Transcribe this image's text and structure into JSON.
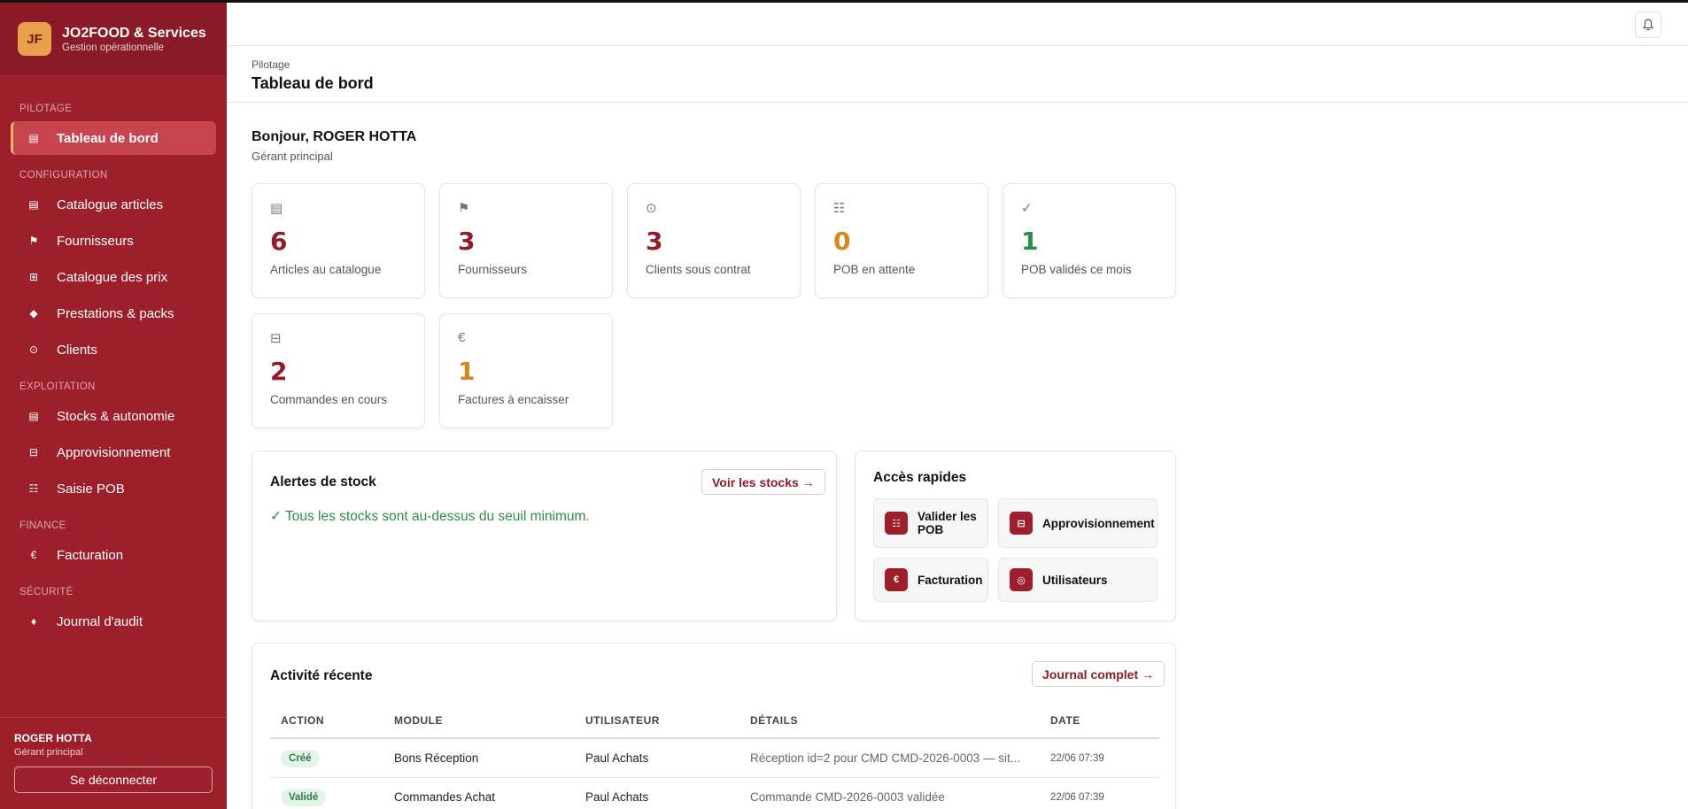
{
  "brand": {
    "logo": "JF",
    "name": "JO2FOOD & Services",
    "subtitle": "Gestion opérationnelle"
  },
  "sidebar": {
    "sections": {
      "pilotage": "PILOTAGE",
      "configuration": "CONFIGURATION",
      "exploitation": "EXPLOITATION",
      "finance": "FINANCE",
      "securite": "SÉCURITÉ"
    },
    "items": [
      {
        "label": "Tableau de bord",
        "icon": "▤"
      },
      {
        "label": "Catalogue articles",
        "icon": "▤"
      },
      {
        "label": "Fournisseurs",
        "icon": "⚑"
      },
      {
        "label": "Catalogue des prix",
        "icon": "⊞"
      },
      {
        "label": "Prestations & packs",
        "icon": "◆"
      },
      {
        "label": "Clients",
        "icon": "⊙"
      },
      {
        "label": "Stocks & autonomie",
        "icon": "▤"
      },
      {
        "label": "Approvisionnement",
        "icon": "⊟"
      },
      {
        "label": "Saisie POB",
        "icon": "☷"
      },
      {
        "label": "Facturation",
        "icon": "€"
      },
      {
        "label": "Journal d'audit",
        "icon": "♦"
      }
    ],
    "user": {
      "name": "ROGER HOTTA",
      "role": "Gérant principal",
      "logout": "Se déconnecter"
    }
  },
  "header": {
    "breadcrumb": "Pilotage",
    "title": "Tableau de bord"
  },
  "greeting": {
    "title": "Bonjour, ROGER HOTTA",
    "role": "Gérant principal"
  },
  "stats": [
    {
      "value": "6",
      "label": "Articles au catalogue",
      "icon": "▤",
      "color": "#8f1c2a"
    },
    {
      "value": "3",
      "label": "Fournisseurs",
      "icon": "⚑",
      "color": "#8f1c2a"
    },
    {
      "value": "3",
      "label": "Clients sous contrat",
      "icon": "⊙",
      "color": "#8f1c2a"
    },
    {
      "value": "0",
      "label": "POB en attente",
      "icon": "☷",
      "color": "#d7871f"
    },
    {
      "value": "1",
      "label": "POB validés ce mois",
      "icon": "✓",
      "color": "#2f8a4e"
    },
    {
      "value": "2",
      "label": "Commandes en cours",
      "icon": "⊟",
      "color": "#8f1c2a"
    },
    {
      "value": "1",
      "label": "Factures à encaisser",
      "icon": "€",
      "color": "#d7871f"
    }
  ],
  "stock_alerts": {
    "title": "Alertes de stock",
    "button": "Voir les stocks →",
    "message": "✓ Tous les stocks sont au-dessus du seuil minimum."
  },
  "quick_access": {
    "title": "Accès rapides",
    "items": [
      {
        "label": "Valider les POB",
        "icon": "☷"
      },
      {
        "label": "Approvisionnement",
        "icon": "⊟"
      },
      {
        "label": "Facturation",
        "icon": "€"
      },
      {
        "label": "Utilisateurs",
        "icon": "◎"
      }
    ]
  },
  "activity": {
    "title": "Activité récente",
    "button": "Journal complet →",
    "columns": [
      "ACTION",
      "MODULE",
      "UTILISATEUR",
      "DÉTAILS",
      "DATE"
    ],
    "rows": [
      {
        "action": "Créé",
        "module": "Bons Réception",
        "user": "Paul Achats",
        "details": "Réception id=2 pour CMD CMD-2026-0003 — sit...",
        "date": "22/06 07:39"
      },
      {
        "action": "Validé",
        "module": "Commandes Achat",
        "user": "Paul Achats",
        "details": "Commande CMD-2026-0003 validée",
        "date": "22/06 07:39"
      }
    ]
  }
}
